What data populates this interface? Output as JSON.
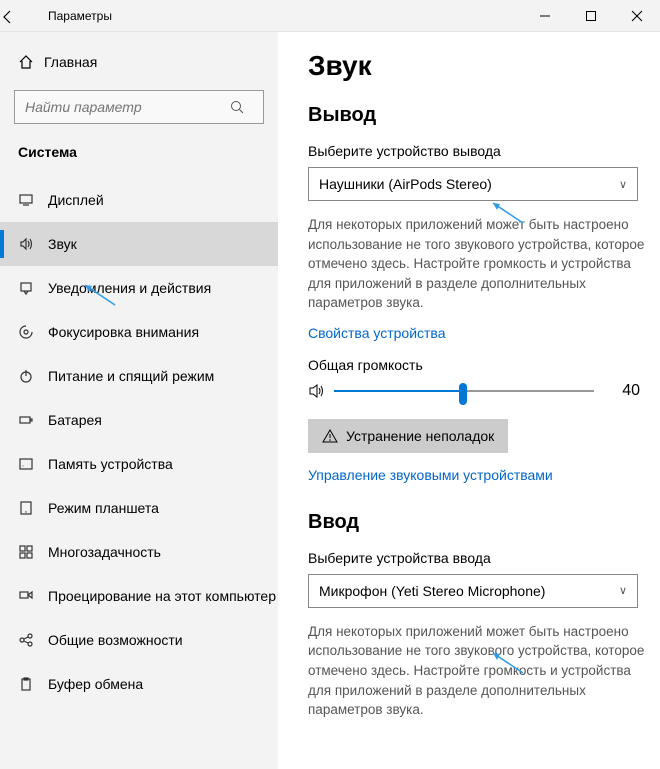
{
  "titlebar": {
    "title": "Параметры"
  },
  "home": {
    "label": "Главная"
  },
  "search": {
    "placeholder": "Найти параметр"
  },
  "section_label": "Система",
  "nav": [
    {
      "label": "Дисплей",
      "icon": "display"
    },
    {
      "label": "Звук",
      "icon": "sound",
      "selected": true
    },
    {
      "label": "Уведомления и действия",
      "icon": "notify"
    },
    {
      "label": "Фокусировка внимания",
      "icon": "focus"
    },
    {
      "label": "Питание и спящий режим",
      "icon": "power"
    },
    {
      "label": "Батарея",
      "icon": "battery"
    },
    {
      "label": "Память устройства",
      "icon": "storage"
    },
    {
      "label": "Режим планшета",
      "icon": "tablet"
    },
    {
      "label": "Многозадачность",
      "icon": "multi"
    },
    {
      "label": "Проецирование на этот компьютер",
      "icon": "project"
    },
    {
      "label": "Общие возможности",
      "icon": "share"
    },
    {
      "label": "Буфер обмена",
      "icon": "clipboard"
    }
  ],
  "page": {
    "title": "Звук",
    "output": {
      "heading": "Вывод",
      "field_label": "Выберите устройство вывода",
      "selected": "Наушники (AirPods Stereo)",
      "desc": "Для некоторых приложений может быть настроено использование не того звукового устройства, которое отмечено здесь. Настройте громкость и устройства для приложений в разделе дополнительных параметров звука.",
      "props_link": "Свойства устройства",
      "volume_label": "Общая громкость",
      "volume_value": "40",
      "troubleshoot": "Устранение неполадок",
      "manage_link": "Управление звуковыми устройствами"
    },
    "input": {
      "heading": "Ввод",
      "field_label": "Выберите устройства ввода",
      "selected": "Микрофон (Yeti Stereo Microphone)",
      "desc": "Для некоторых приложений может быть настроено использование не того звукового устройства, которое отмечено здесь. Настройте громкость и устройства для приложений в разделе дополнительных параметров звука."
    }
  }
}
